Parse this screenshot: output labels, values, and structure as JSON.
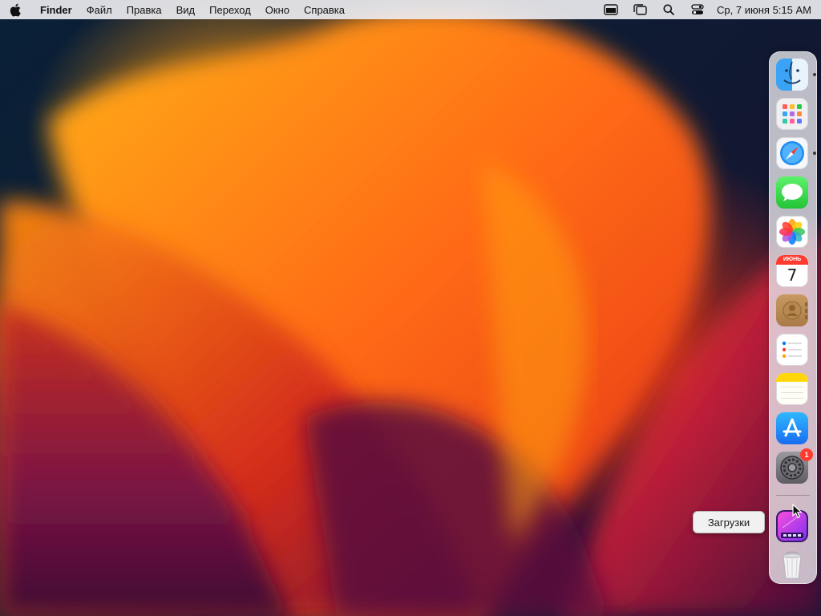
{
  "menubar": {
    "app_name": "Finder",
    "items": [
      "Файл",
      "Правка",
      "Вид",
      "Переход",
      "Окно",
      "Справка"
    ],
    "clock": "Ср, 7 июня  5:15 AM"
  },
  "dock": {
    "apps": [
      {
        "name": "Finder",
        "icon": "finder-icon",
        "running": true
      },
      {
        "name": "Launchpad",
        "icon": "launchpad-icon",
        "running": false
      },
      {
        "name": "Safari",
        "icon": "safari-icon",
        "running": true
      },
      {
        "name": "Messages",
        "icon": "messages-icon",
        "running": false
      },
      {
        "name": "Photos",
        "icon": "photos-icon",
        "running": false
      },
      {
        "name": "Calendar",
        "icon": "calendar-icon",
        "running": false
      },
      {
        "name": "Contacts",
        "icon": "contacts-icon",
        "running": false
      },
      {
        "name": "Reminders",
        "icon": "reminders-icon",
        "running": false
      },
      {
        "name": "Notes",
        "icon": "notes-icon",
        "running": false
      },
      {
        "name": "App Store",
        "icon": "app-store-icon",
        "running": false
      },
      {
        "name": "System Settings",
        "icon": "system-settings-icon",
        "running": false
      }
    ],
    "calendar": {
      "month": "ИЮНЬ",
      "day": "7"
    },
    "settings_badge": "1",
    "downloads_tooltip": "Загрузки"
  },
  "colors": {
    "menubar_bg": "#ececf0",
    "badge": "#ff3b30",
    "accent_orange": "#ff7b12"
  }
}
